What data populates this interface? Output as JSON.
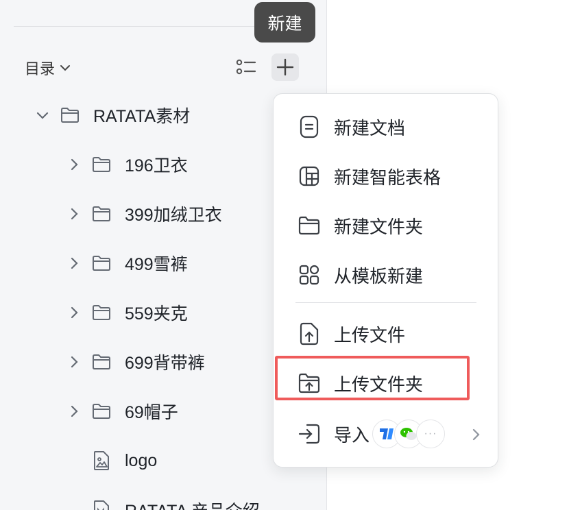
{
  "tooltip": {
    "text": "新建"
  },
  "sidebar": {
    "directory_label": "目录",
    "tree": [
      {
        "label": "RATATA素材",
        "type": "folder",
        "expanded": true,
        "level": 0
      },
      {
        "label": "196卫衣",
        "type": "folder",
        "expanded": false,
        "level": 1
      },
      {
        "label": "399加绒卫衣",
        "type": "folder",
        "expanded": false,
        "level": 1
      },
      {
        "label": "499雪裤",
        "type": "folder",
        "expanded": false,
        "level": 1
      },
      {
        "label": "559夹克",
        "type": "folder",
        "expanded": false,
        "level": 1
      },
      {
        "label": "699背带裤",
        "type": "folder",
        "expanded": false,
        "level": 1
      },
      {
        "label": "69帽子",
        "type": "folder",
        "expanded": false,
        "level": 1
      },
      {
        "label": "logo",
        "type": "image",
        "level": 1
      },
      {
        "label": "RATATA 产品介绍",
        "type": "file",
        "level": 1
      }
    ]
  },
  "menu": {
    "items": [
      {
        "label": "新建文档",
        "icon": "doc-icon"
      },
      {
        "label": "新建智能表格",
        "icon": "table-icon"
      },
      {
        "label": "新建文件夹",
        "icon": "folder-icon"
      },
      {
        "label": "从模板新建",
        "icon": "template-grid-icon"
      },
      {
        "label": "上传文件",
        "icon": "upload-file-icon"
      },
      {
        "label": "上传文件夹",
        "icon": "upload-folder-icon"
      },
      {
        "label": "导入",
        "icon": "import-icon"
      }
    ],
    "import_more": "···"
  },
  "colors": {
    "highlight": "#ef5b5b",
    "sidebar_bg": "#f5f6f8",
    "tooltip_bg": "#4a4a4a"
  }
}
